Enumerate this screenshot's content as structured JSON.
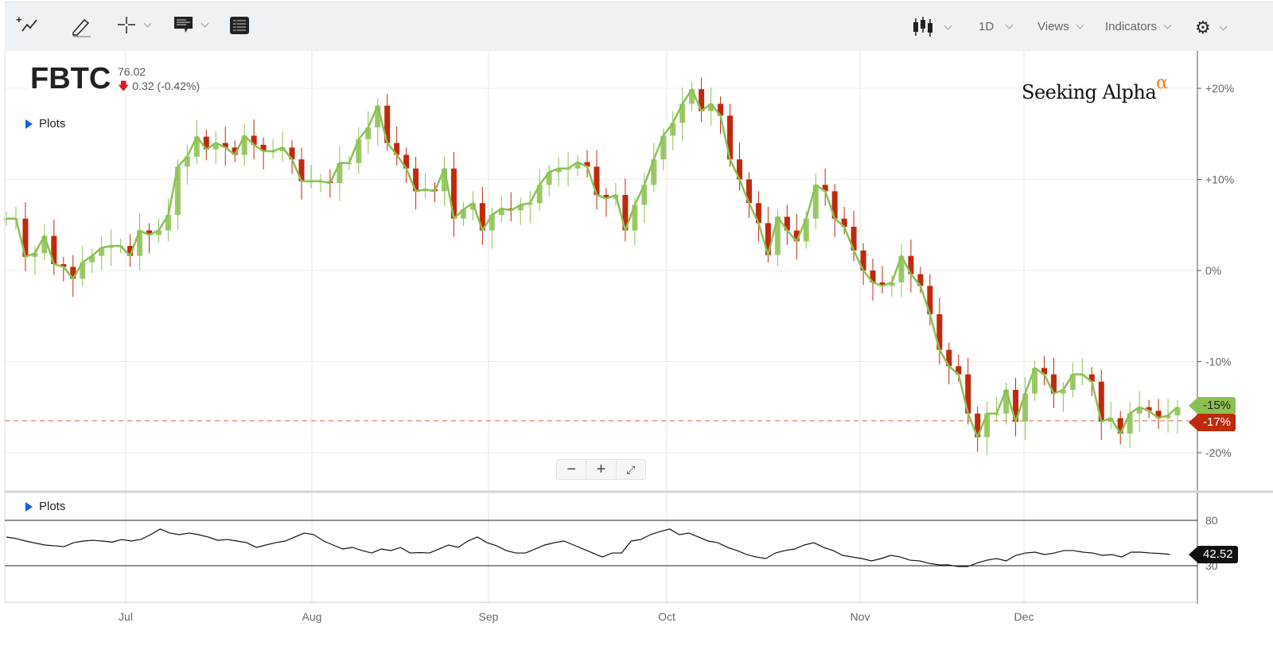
{
  "toolbar": {
    "chart_type_icon": "candlestick-icon",
    "interval": "1D",
    "views": "Views",
    "indicators": "Indicators"
  },
  "symbol": {
    "ticker": "FBTC",
    "price": "76.02",
    "change": "0.32 (-0.42%)",
    "direction": "down"
  },
  "plots_label": "Plots",
  "indicator_plots_label": "Plots",
  "logo": {
    "text": "Seeking Alpha",
    "mark": "α"
  },
  "zoom": {
    "minus": "−",
    "plus": "+",
    "fullscreen": "⤢"
  },
  "colors": {
    "up": "#8cc152",
    "down": "#c1290d",
    "line": "#8cc152",
    "label_current": "#8cc152",
    "label_ref": "#c1290d"
  },
  "chart_data": {
    "type": "line",
    "title": "FBTC",
    "y_unit": "% change",
    "ylim": [
      -23,
      24
    ],
    "yticks": [
      20,
      10,
      0,
      -10,
      -20
    ],
    "ytick_labels": [
      "+20%",
      "+10%",
      "0%",
      "-10%",
      "-20%"
    ],
    "xtick_labels": [
      "Jul",
      "Aug",
      "Sep",
      "Oct",
      "Nov",
      "Dec"
    ],
    "grid": true,
    "series": [
      {
        "name": "FBTC",
        "values": [
          5.7,
          5.7,
          1.5,
          1.9,
          3.8,
          0.7,
          0.4,
          -0.9,
          0.9,
          1.6,
          2.5,
          2.7,
          2.7,
          1.6,
          4.4,
          3.9,
          4.4,
          6.1,
          11.4,
          12.5,
          14.7,
          13.3,
          14.0,
          13.5,
          12.7,
          14.8,
          13.8,
          13.1,
          13.1,
          13.5,
          12.2,
          9.8,
          9.8,
          9.8,
          9.6,
          11.8,
          11.8,
          14.4,
          15.7,
          18.1,
          14.0,
          12.7,
          11.2,
          8.7,
          8.9,
          8.7,
          11.2,
          5.7,
          6.7,
          7.4,
          4.4,
          6.1,
          6.8,
          6.6,
          7.2,
          7.4,
          9.4,
          10.8,
          11.2,
          11.2,
          11.9,
          11.4,
          8.3,
          7.9,
          8.3,
          4.4,
          7.2,
          9.4,
          12.2,
          14.8,
          16.2,
          18.3,
          19.9,
          17.5,
          18.3,
          17.0,
          12.2,
          10.0,
          7.4,
          5.2,
          1.7,
          5.9,
          4.4,
          3.2,
          5.7,
          9.4,
          8.7,
          5.7,
          4.8,
          2.2,
          0,
          -1.3,
          -1.7,
          -1.3,
          1.6,
          -0.4,
          -1.7,
          -4.8,
          -8.7,
          -10.5,
          -11.4,
          -15.7,
          -18.3,
          -15.7,
          -15.7,
          -13.1,
          -16.6,
          -13.5,
          -10.7,
          -11.4,
          -13.5,
          -13.1,
          -11.4,
          -11.4,
          -12.2,
          -16.6,
          -16.2,
          -17.9,
          -15.7,
          -15.0,
          -15.4,
          -16.2,
          -15.9,
          -15.0
        ]
      }
    ],
    "current_label": "-15%",
    "reference_line": {
      "value": -16.5,
      "label": "-17%"
    },
    "indicator": {
      "ylim": [
        15,
        100
      ],
      "levels": [
        80,
        30
      ],
      "level_labels": [
        "80",
        "30"
      ],
      "last_label": "42.52",
      "values": [
        61.6,
        60,
        57.2,
        55,
        52.8,
        52,
        51,
        55.4,
        57.2,
        58,
        57.2,
        56,
        58.9,
        57.2,
        59,
        64.2,
        70.4,
        66,
        64.2,
        66,
        64.2,
        61.6,
        58,
        58.9,
        57.2,
        55.4,
        50.2,
        52.8,
        55.4,
        57.2,
        61.6,
        66,
        64.2,
        57.2,
        52.8,
        48.4,
        50.2,
        46.7,
        44,
        48.4,
        46.7,
        50.2,
        44,
        44.5,
        44,
        48.4,
        52.8,
        50.2,
        57.2,
        61.6,
        55.4,
        52,
        46.7,
        44,
        44,
        48.4,
        52.8,
        55.4,
        57.2,
        52.8,
        48.4,
        44,
        39.6,
        44,
        44,
        57.2,
        58.9,
        64.2,
        67.7,
        70.4,
        64.2,
        66,
        61.6,
        57.2,
        55.4,
        50.2,
        46.7,
        42.3,
        39.6,
        37.9,
        44,
        46.7,
        48.4,
        52.8,
        55.4,
        50.2,
        46.7,
        41.4,
        39.6,
        37.9,
        35.3,
        37.9,
        41.4,
        39.6,
        36.1,
        35.3,
        32.6,
        30.9,
        30.9,
        29.1,
        29.1,
        33,
        36.1,
        37.9,
        35.3,
        41.4,
        44,
        44.9,
        42.3,
        44,
        46.7,
        46.7,
        44.9,
        44,
        41.4,
        42.3,
        39.6,
        44.9,
        44.9,
        44,
        43.5,
        42.5
      ]
    }
  }
}
